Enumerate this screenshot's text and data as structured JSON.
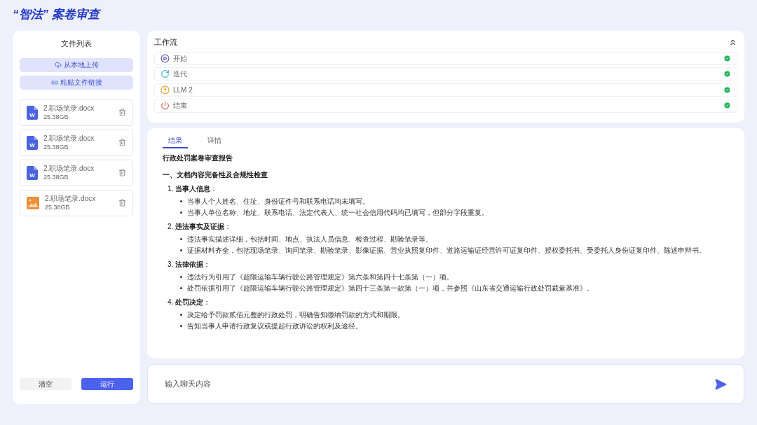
{
  "title": "“智法” 案卷审查",
  "file_panel": {
    "title": "文件列表",
    "buttons": [
      {
        "kind": "upload",
        "label": "从本地上传"
      },
      {
        "kind": "link",
        "label": "粘贴文件链接"
      }
    ],
    "files": [
      {
        "kind": "word",
        "icon_text": "W",
        "name": "2.职场笔录.docx",
        "size": "25.38GB"
      },
      {
        "kind": "word",
        "icon_text": "W",
        "name": "2.职场笔录.docx",
        "size": "25.38GB"
      },
      {
        "kind": "word",
        "icon_text": "W",
        "name": "2.职场笔录.docx",
        "size": "25.38GB"
      },
      {
        "kind": "image",
        "name": "2.职场笔录.docx",
        "size": "25.38GB"
      }
    ],
    "actions": [
      {
        "kind": "secondary",
        "label": "清空"
      },
      {
        "kind": "primary",
        "label": "运行"
      }
    ]
  },
  "workflow": {
    "title": "工作流",
    "expanded": true,
    "steps": [
      {
        "kind": "start",
        "label": "开始",
        "done": true
      },
      {
        "kind": "iterate",
        "label": "迭代",
        "done": true
      },
      {
        "kind": "llm",
        "label": "LLM 2",
        "done": true
      },
      {
        "kind": "end",
        "label": "结束",
        "done": true
      }
    ]
  },
  "result": {
    "tabs": [
      {
        "label": "结果",
        "selected": true
      },
      {
        "label": "详情",
        "selected": false
      }
    ],
    "report_title": "行政处罚案卷审查报告",
    "section_heading": "一、文档内容完备性及合规性检查",
    "items": [
      {
        "heading": "1. **当事人信息**：",
        "bullets": [
          "当事人个人姓名、住址、身份证件号和联系电话均未填写。",
          "当事人单位名称、地址、联系电话、法定代表人、统一社会信用代码均已填写，但部分字段重复。"
        ]
      },
      {
        "heading": "2. **违法事实及证据**：",
        "bullets": [
          "违法事实描述详细，包括时间、地点、执法人员信息、检查过程、勘验笔录等。",
          "证据材料齐全，包括现场笔录、询问笔录、勘验笔录、影像证据、营业执照复印件、道路运输证经营许可证复印件、授权委托书、受委托人身份证复印件、陈述申辩书。"
        ]
      },
      {
        "heading": "3. **法律依据**：",
        "bullets": [
          "违法行为引用了《超限运输车辆行驶公路管理规定》第六条和第四十七条第（一）项。",
          "处罚依据引用了《超限运输车辆行驶公路管理规定》第四十三条第一款第（一）项，并参照《山东省交通运输行政处罚裁量基准》。"
        ]
      },
      {
        "heading": "4. **处罚决定**：",
        "bullets": [
          "决定给予罚款贰佰元整的行政处罚，明确告知缴纳罚款的方式和期限。",
          "告知当事人申请行政复议或提起行政诉讼的权利及途径。"
        ]
      }
    ]
  },
  "chat": {
    "placeholder": "输入聊天内容"
  }
}
